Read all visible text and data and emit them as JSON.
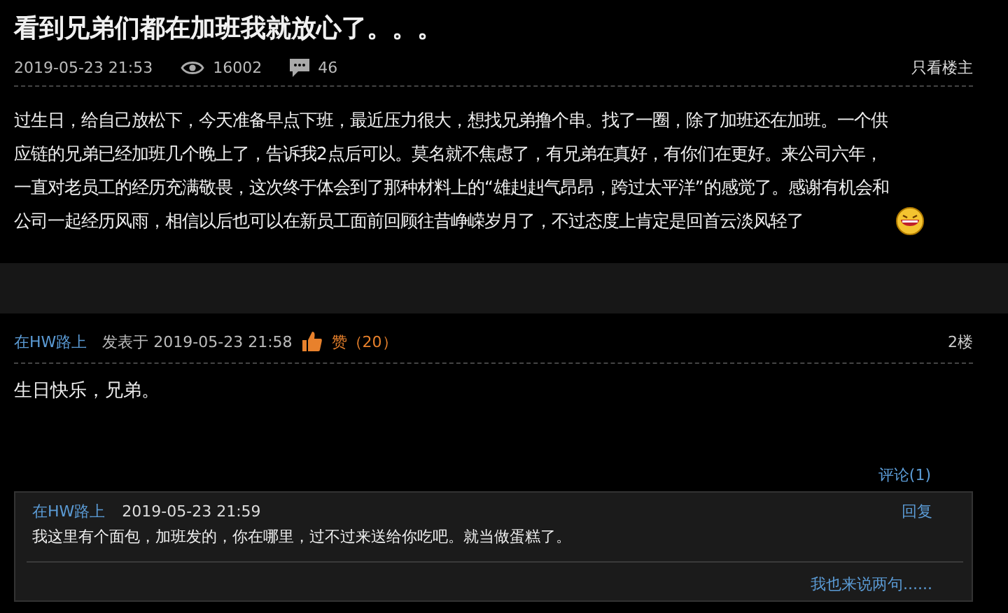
{
  "post": {
    "title": "看到兄弟们都在加班我就放心了。。。",
    "date": "2019-05-23 21:53",
    "views": "16002",
    "comments": "46",
    "only_author": "只看楼主",
    "body": "过生日，给自己放松下，今天准备早点下班，最近压力很大，想找兄弟撸个串。找了一圈，除了加班还在加班。一个供应链的兄弟已经加班几个晚上了，告诉我2点后可以。莫名就不焦虑了，有兄弟在真好，有你们在更好。来公司六年，一直对老员工的经历充满敬畏，这次终于体会到了那种材料上的“雄赳赳气昂昂，跨过太平洋”的感觉了。感谢有机会和公司一起经历风雨，相信以后也可以在新员工面前回顾往昔峥嵘岁月了，不过态度上肯定是回首云淡风轻了"
  },
  "reply": {
    "author": "在HW路上",
    "posted": "发表于 2019-05-23 21:58",
    "like": "赞（20）",
    "floor": "2楼",
    "body": "生日快乐，兄弟。",
    "comments_link": "评论(1)",
    "comments": [
      {
        "author": "在HW路上",
        "date": "2019-05-23 21:59",
        "reply": "回复",
        "body": "我这里有个面包，加班发的，你在哪里，过不过来送给你吃吧。就当做蛋糕了。"
      }
    ],
    "add_comment": "我也来说两句......"
  }
}
